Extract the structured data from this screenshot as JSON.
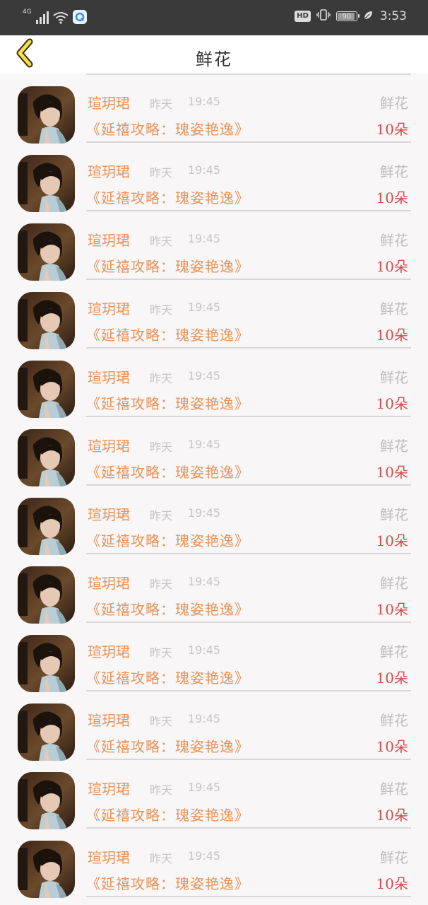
{
  "status_bar": {
    "network": "4G",
    "signal_level": 4,
    "hd_label": "HD",
    "battery": "90",
    "time": "3:53"
  },
  "header": {
    "title": "鲜花",
    "back_icon": "chevron-left-icon",
    "accent_color": "#f5e04a"
  },
  "colors": {
    "name": "#e8935a",
    "meta": "#c8c4c4",
    "count": "#d44b4b"
  },
  "records": [
    {
      "user": "瑄玥珺",
      "date": "昨天",
      "time": "19:45",
      "gift": "鲜花",
      "drama": "《延禧攻略：瑰姿艳逸》",
      "count": "10朵"
    },
    {
      "user": "瑄玥珺",
      "date": "昨天",
      "time": "19:45",
      "gift": "鲜花",
      "drama": "《延禧攻略：瑰姿艳逸》",
      "count": "10朵"
    },
    {
      "user": "瑄玥珺",
      "date": "昨天",
      "time": "19:45",
      "gift": "鲜花",
      "drama": "《延禧攻略：瑰姿艳逸》",
      "count": "10朵"
    },
    {
      "user": "瑄玥珺",
      "date": "昨天",
      "time": "19:45",
      "gift": "鲜花",
      "drama": "《延禧攻略：瑰姿艳逸》",
      "count": "10朵"
    },
    {
      "user": "瑄玥珺",
      "date": "昨天",
      "time": "19:45",
      "gift": "鲜花",
      "drama": "《延禧攻略：瑰姿艳逸》",
      "count": "10朵"
    },
    {
      "user": "瑄玥珺",
      "date": "昨天",
      "time": "19:45",
      "gift": "鲜花",
      "drama": "《延禧攻略：瑰姿艳逸》",
      "count": "10朵"
    },
    {
      "user": "瑄玥珺",
      "date": "昨天",
      "time": "19:45",
      "gift": "鲜花",
      "drama": "《延禧攻略：瑰姿艳逸》",
      "count": "10朵"
    },
    {
      "user": "瑄玥珺",
      "date": "昨天",
      "time": "19:45",
      "gift": "鲜花",
      "drama": "《延禧攻略：瑰姿艳逸》",
      "count": "10朵"
    },
    {
      "user": "瑄玥珺",
      "date": "昨天",
      "time": "19:45",
      "gift": "鲜花",
      "drama": "《延禧攻略：瑰姿艳逸》",
      "count": "10朵"
    },
    {
      "user": "瑄玥珺",
      "date": "昨天",
      "time": "19:45",
      "gift": "鲜花",
      "drama": "《延禧攻略：瑰姿艳逸》",
      "count": "10朵"
    },
    {
      "user": "瑄玥珺",
      "date": "昨天",
      "time": "19:45",
      "gift": "鲜花",
      "drama": "《延禧攻略：瑰姿艳逸》",
      "count": "10朵"
    },
    {
      "user": "瑄玥珺",
      "date": "昨天",
      "time": "19:45",
      "gift": "鲜花",
      "drama": "《延禧攻略：瑰姿艳逸》",
      "count": "10朵"
    }
  ]
}
